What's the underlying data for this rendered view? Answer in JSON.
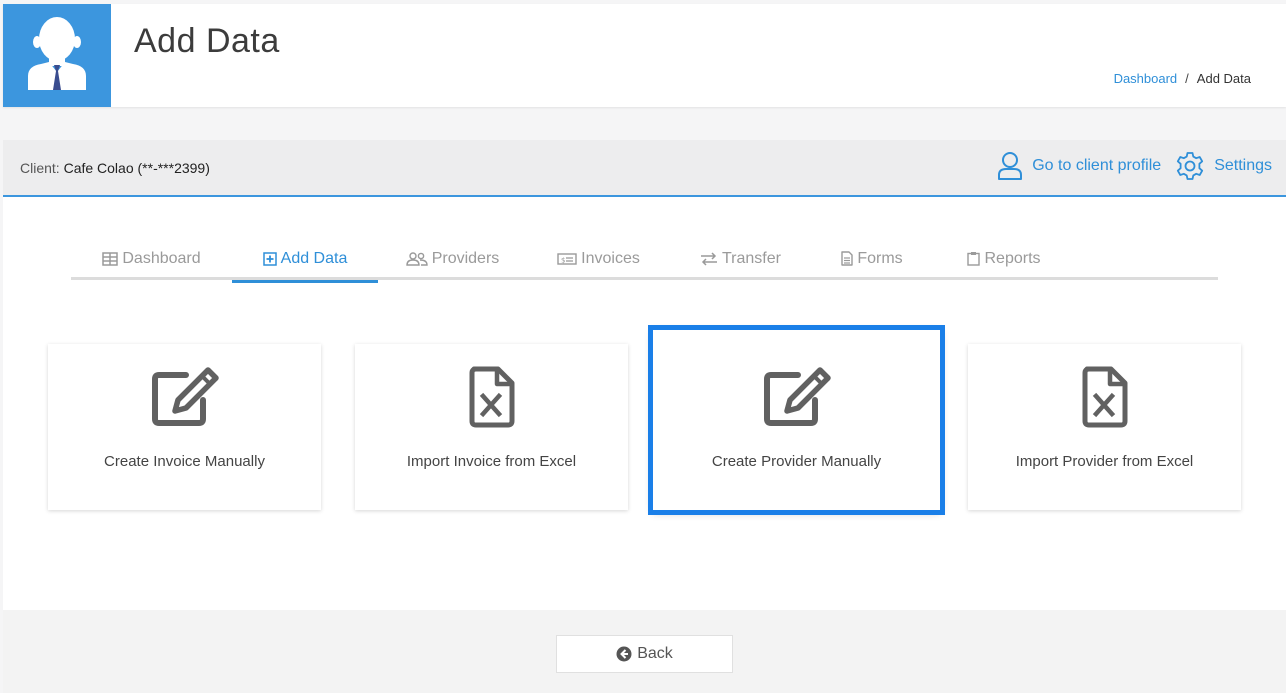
{
  "header": {
    "title": "Add Data",
    "breadcrumb": {
      "link": "Dashboard",
      "separator": "/",
      "current": "Add Data"
    }
  },
  "client_bar": {
    "label": "Client:",
    "name": "Cafe Colao (**-***2399)",
    "profile_link": "Go to client profile",
    "settings_link": "Settings"
  },
  "tabs": [
    {
      "label": "Dashboard",
      "icon": "table-icon",
      "active": false
    },
    {
      "label": "Add Data",
      "icon": "plus-square-icon",
      "active": true
    },
    {
      "label": "Providers",
      "icon": "users-icon",
      "active": false
    },
    {
      "label": "Invoices",
      "icon": "money-bill-icon",
      "active": false
    },
    {
      "label": "Transfer",
      "icon": "exchange-icon",
      "active": false
    },
    {
      "label": "Forms",
      "icon": "file-text-icon",
      "active": false
    },
    {
      "label": "Reports",
      "icon": "clipboard-icon",
      "active": false
    }
  ],
  "cards": [
    {
      "label": "Create Invoice Manually",
      "icon": "edit-icon",
      "selected": false
    },
    {
      "label": "Import Invoice from Excel",
      "icon": "excel-file-icon",
      "selected": false
    },
    {
      "label": "Create Provider Manually",
      "icon": "edit-icon",
      "selected": true
    },
    {
      "label": "Import Provider from Excel",
      "icon": "excel-file-icon",
      "selected": false
    }
  ],
  "footer": {
    "back_label": "Back",
    "back_icon": "arrow-circle-left-icon"
  },
  "colors": {
    "accent": "#2f8fd8",
    "avatar_bg": "#3c96de",
    "selection": "#1a7fe8"
  }
}
